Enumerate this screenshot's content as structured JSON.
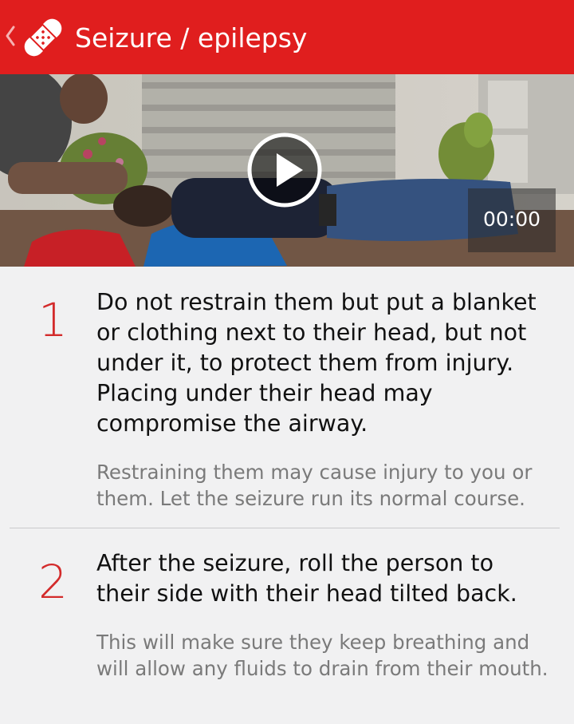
{
  "header": {
    "title": "Seizure / epilepsy",
    "back_icon": "chevron-left-icon",
    "logo_icon": "bandage-icon",
    "background_color": "#e01e1e"
  },
  "video": {
    "play_icon": "play-icon",
    "time": "00:00"
  },
  "steps": [
    {
      "number": "1",
      "text": "Do not restrain them but put a blanket or clothing next to their head, but not under it, to protect them from injury. Placing under their head may compromise the airway.",
      "note": "Restraining them may cause injury to you or them. Let the seizure run its normal course."
    },
    {
      "number": "2",
      "text": "After the seizure, roll the person to their side with their head tilted back.",
      "note": "This will make sure they keep breathing and will allow any fluids to drain from their mouth."
    }
  ],
  "colors": {
    "accent": "#d32b2b",
    "page_background": "#f1f1f2",
    "note_text": "#7a7a7a"
  }
}
